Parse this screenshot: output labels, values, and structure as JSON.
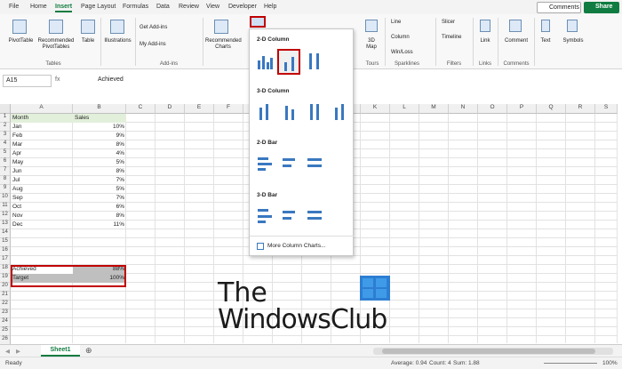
{
  "tabs": [
    "File",
    "Home",
    "Insert",
    "Page Layout",
    "Formulas",
    "Data",
    "Review",
    "View",
    "Developer",
    "Help"
  ],
  "active_tab": "Insert",
  "buttons": {
    "comments": "Comments",
    "share": "Share"
  },
  "ribbon": {
    "pivot": "PivotTable",
    "rec_pivot": "Recommended\nPivotTables",
    "table": "Table",
    "tables_grp": "Tables",
    "illustrations": "Illustrations",
    "get_addins": "Get Add-ins",
    "my_addins": "My Add-ins",
    "addins_grp": "Add-ins",
    "rec_charts": "Recommended\nCharts",
    "map3d": "3D\nMap",
    "tours_grp": "Tours",
    "line": "Line",
    "column": "Column",
    "winloss": "Win/Loss",
    "sparklines_grp": "Sparklines",
    "slicer": "Slicer",
    "timeline": "Timeline",
    "filters_grp": "Filters",
    "link": "Link",
    "links_grp": "Links",
    "comment": "Comment",
    "comments_grp": "Comments",
    "text": "Text",
    "symbols": "Symbols"
  },
  "namebox": "A15",
  "formula": "Achieved",
  "columns": [
    "A",
    "B",
    "C",
    "D",
    "E",
    "F",
    "G",
    "H",
    "I",
    "J",
    "K",
    "L",
    "M",
    "N",
    "O",
    "P",
    "Q",
    "R",
    "S"
  ],
  "rows": [
    "1",
    "2",
    "3",
    "4",
    "5",
    "6",
    "7",
    "8",
    "9",
    "10",
    "11",
    "12",
    "13",
    "14",
    "15",
    "16",
    "17",
    "18",
    "19",
    "20",
    "21",
    "22",
    "23",
    "24",
    "25",
    "26"
  ],
  "table": {
    "header": [
      "Month",
      "Sales"
    ],
    "data": [
      [
        "Jan",
        "10%"
      ],
      [
        "Feb",
        "9%"
      ],
      [
        "Mar",
        "8%"
      ],
      [
        "Apr",
        "4%"
      ],
      [
        "May",
        "5%"
      ],
      [
        "Jun",
        "8%"
      ],
      [
        "Jul",
        "7%"
      ],
      [
        "Aug",
        "5%"
      ],
      [
        "Sep",
        "7%"
      ],
      [
        "Oct",
        "6%"
      ],
      [
        "Nov",
        "8%"
      ],
      [
        "Dec",
        "11%"
      ]
    ],
    "achieved": [
      "Achieved",
      "88%"
    ],
    "target": [
      "Target",
      "100%"
    ]
  },
  "dropdown": {
    "col2d": "2-D Column",
    "col3d": "3-D Column",
    "bar2d": "2-D Bar",
    "bar3d": "3-D Bar",
    "more": "More Column Charts..."
  },
  "sheet": "Sheet1",
  "status": {
    "ready": "Ready",
    "average": "Average: 0.94",
    "count": "Count: 4",
    "sum": "Sum: 1.88",
    "zoom": "100%"
  },
  "watermark": {
    "line1": "The",
    "line2": "WindowsClub"
  },
  "colors": {
    "accent": "#107c41",
    "selection": "#c00000",
    "chart_blue": "#3a78c0"
  }
}
